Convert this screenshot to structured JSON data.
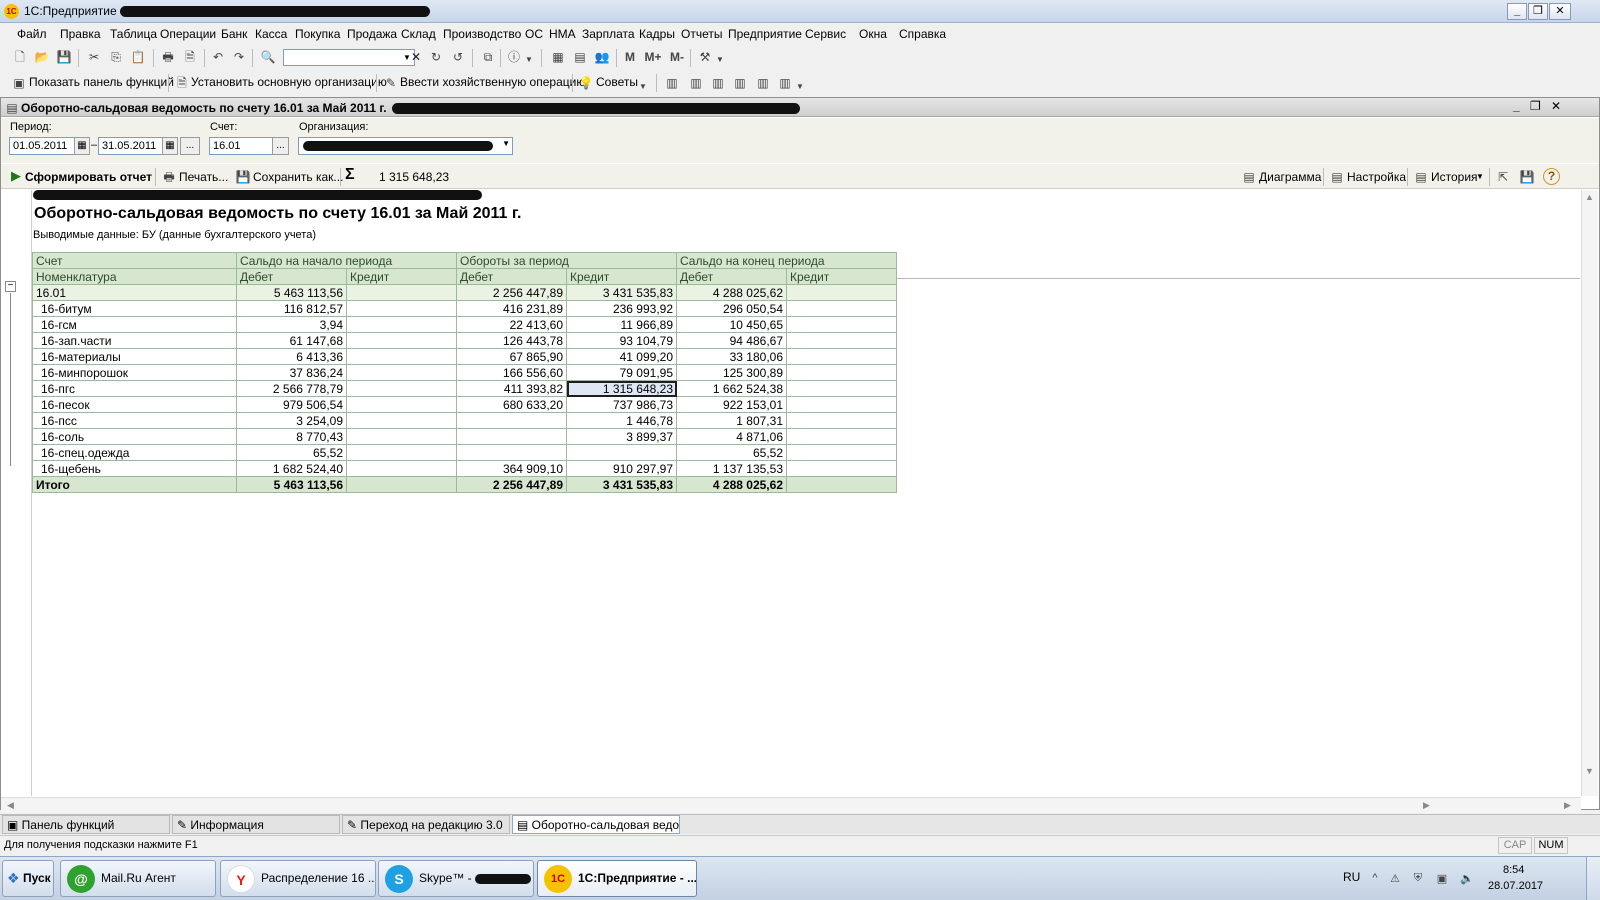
{
  "app": {
    "title": "1С:Предприятие - "
  },
  "menu": [
    "Файл",
    "Правка",
    "Таблица",
    "Операции",
    "Банк",
    "Касса",
    "Покупка",
    "Продажа",
    "Склад",
    "Производство",
    "ОС",
    "НМА",
    "Зарплата",
    "Кадры",
    "Отчеты",
    "Предприятие",
    "Сервис",
    "Окна",
    "Справка"
  ],
  "toolbar2": {
    "show_panel": "Показать панель функций",
    "set_org": "Установить основную организацию",
    "enter_op": "Ввести хозяйственную операцию",
    "tips": "Советы"
  },
  "document": {
    "title": "Оборотно-сальдовая ведомость по счету 16.01 за Май 2011 г. "
  },
  "params": {
    "period_label": "Период:",
    "date_from": "01.05.2011",
    "date_to": "31.05.2011",
    "dash": "–",
    "dots": "...",
    "account_label": "Счет:",
    "account": "16.01",
    "org_label": "Организация:"
  },
  "actions": {
    "generate": "Сформировать отчет",
    "print": "Печать...",
    "save": "Сохранить как...",
    "sum_value": "1 315 648,23",
    "chart": "Диаграмма",
    "settings": "Настройка",
    "history": "История"
  },
  "report": {
    "title": "Оборотно-сальдовая ведомость по счету 16.01 за Май 2011 г.",
    "subtitle": "Выводимые данные:  БУ (данные бухгалтерского учета)",
    "header1": [
      "Счет",
      "Сальдо на начало периода",
      "Обороты за период",
      "Сальдо на конец периода"
    ],
    "header2": [
      "Номенклатура",
      "Дебет",
      "Кредит",
      "Дебет",
      "Кредит",
      "Дебет",
      "Кредит"
    ],
    "group": [
      "16.01",
      "5 463 113,56",
      "",
      "2 256 447,89",
      "3 431 535,83",
      "4 288 025,62",
      ""
    ],
    "rows": [
      [
        "16-битум",
        "116 812,57",
        "",
        "416 231,89",
        "236 993,92",
        "296 050,54",
        ""
      ],
      [
        "16-гсм",
        "3,94",
        "",
        "22 413,60",
        "11 966,89",
        "10 450,65",
        ""
      ],
      [
        "16-зап.части",
        "61 147,68",
        "",
        "126 443,78",
        "93 104,79",
        "94 486,67",
        ""
      ],
      [
        "16-материалы",
        "6 413,36",
        "",
        "67 865,90",
        "41 099,20",
        "33 180,06",
        ""
      ],
      [
        "16-минпорошок",
        "37 836,24",
        "",
        "166 556,60",
        "79 091,95",
        "125 300,89",
        ""
      ],
      [
        "16-пгс",
        "2 566 778,79",
        "",
        "411 393,82",
        "1 315 648,23",
        "1 662 524,38",
        ""
      ],
      [
        "16-песок",
        "979 506,54",
        "",
        "680 633,20",
        "737 986,73",
        "922 153,01",
        ""
      ],
      [
        "16-псс",
        "3 254,09",
        "",
        "",
        "1 446,78",
        "1 807,31",
        ""
      ],
      [
        "16-соль",
        "8 770,43",
        "",
        "",
        "3 899,37",
        "4 871,06",
        ""
      ],
      [
        "16-спец.одежда",
        "65,52",
        "",
        "",
        "",
        "65,52",
        ""
      ],
      [
        "16-щебень",
        "1 682 524,40",
        "",
        "364 909,10",
        "910 297,97",
        "1 137 135,53",
        ""
      ]
    ],
    "total": [
      "Итого",
      "5 463 113,56",
      "",
      "2 256 447,89",
      "3 431 535,83",
      "4 288 025,62",
      ""
    ]
  },
  "window_tabs": [
    "Панель функций",
    "Информация",
    "Переход на редакцию 3.0",
    "Оборотно-сальдовая ведом..."
  ],
  "status": {
    "hint": "Для получения подсказки нажмите F1",
    "cap": "CAP",
    "num": "NUM"
  },
  "taskbar": {
    "start": "Пуск",
    "items": [
      "Mail.Ru Агент",
      "Распределение 16 ...",
      "Skype™ - ",
      "1С:Предприятие - ..."
    ],
    "lang": "RU",
    "time": "8:54",
    "date": "28.07.2017"
  }
}
